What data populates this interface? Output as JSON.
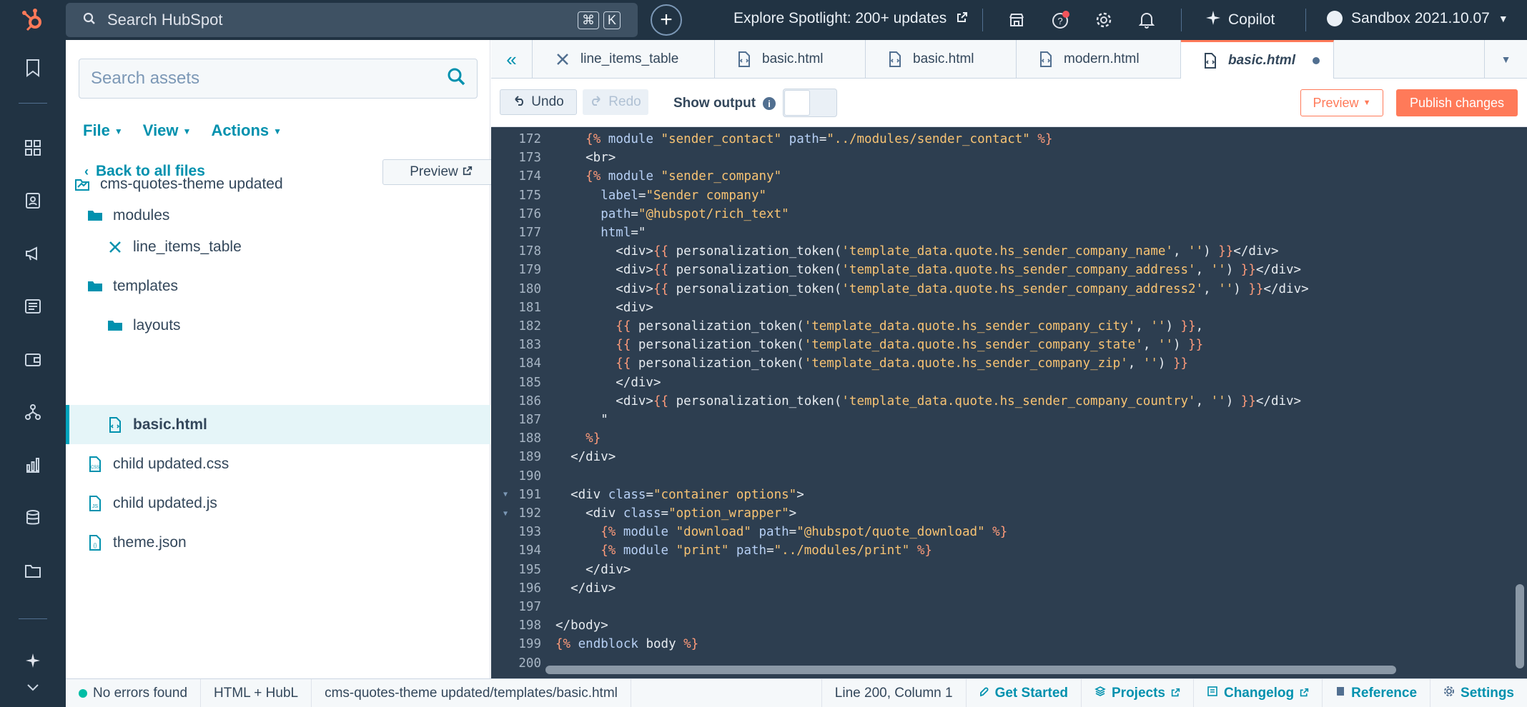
{
  "topbar": {
    "search_placeholder": "Search HubSpot",
    "shortcut_keys": [
      "⌘",
      "K"
    ],
    "spotlight": "Explore Spotlight: 200+ updates",
    "copilot": "Copilot",
    "account": "Sandbox 2021.10.07"
  },
  "sidebar": {
    "search_placeholder": "Search assets",
    "menus": [
      "File",
      "View",
      "Actions"
    ],
    "back_label": "Back to all files",
    "preview_label": "Preview",
    "tree": [
      {
        "label": "cms-quotes-theme updated",
        "icon": "theme-icon"
      },
      {
        "label": "modules",
        "icon": "folder-open-icon"
      },
      {
        "label": "line_items_table",
        "icon": "module-icon"
      },
      {
        "label": "templates",
        "icon": "folder-open-icon"
      },
      {
        "label": "layouts",
        "icon": "folder-icon"
      },
      {
        "label": "basic.html",
        "icon": "html-file-icon",
        "selected": true
      },
      {
        "label": "child updated.css",
        "icon": "css-file-icon"
      },
      {
        "label": "child updated.js",
        "icon": "js-file-icon"
      },
      {
        "label": "theme.json",
        "icon": "json-file-icon"
      }
    ]
  },
  "tabs": [
    {
      "label": "line_items_table",
      "icon": "module-icon"
    },
    {
      "label": "basic.html",
      "icon": "html-file-icon"
    },
    {
      "label": "basic.html",
      "icon": "html-file-icon"
    },
    {
      "label": "modern.html",
      "icon": "html-file-icon"
    },
    {
      "label": "basic.html",
      "icon": "html-file-icon",
      "active": true,
      "unsaved": true
    }
  ],
  "toolbar": {
    "undo": "Undo",
    "redo": "Redo",
    "show_output": "Show output",
    "preview": "Preview",
    "publish": "Publish changes"
  },
  "editor": {
    "lines": [
      {
        "n": "172",
        "code": "    {% module \"sender_contact\" path=\"../modules/sender_contact\" %}"
      },
      {
        "n": "173",
        "code": "    <br>"
      },
      {
        "n": "174",
        "code": "    {% module \"sender_company\""
      },
      {
        "n": "175",
        "code": "      label=\"Sender company\""
      },
      {
        "n": "176",
        "code": "      path=\"@hubspot/rich_text\""
      },
      {
        "n": "177",
        "code": "      html=\""
      },
      {
        "n": "178",
        "code": "        <div>{{ personalization_token('template_data.quote.hs_sender_company_name', '') }}</div>"
      },
      {
        "n": "179",
        "code": "        <div>{{ personalization_token('template_data.quote.hs_sender_company_address', '') }}</div>"
      },
      {
        "n": "180",
        "code": "        <div>{{ personalization_token('template_data.quote.hs_sender_company_address2', '') }}</div>"
      },
      {
        "n": "181",
        "code": "        <div>"
      },
      {
        "n": "182",
        "code": "        {{ personalization_token('template_data.quote.hs_sender_company_city', '') }},"
      },
      {
        "n": "183",
        "code": "        {{ personalization_token('template_data.quote.hs_sender_company_state', '') }}"
      },
      {
        "n": "184",
        "code": "        {{ personalization_token('template_data.quote.hs_sender_company_zip', '') }}"
      },
      {
        "n": "185",
        "code": "        </div>"
      },
      {
        "n": "186",
        "code": "        <div>{{ personalization_token('template_data.quote.hs_sender_company_country', '') }}</div>"
      },
      {
        "n": "187",
        "code": "      \""
      },
      {
        "n": "188",
        "code": "    %}"
      },
      {
        "n": "189",
        "code": "  </div>"
      },
      {
        "n": "190",
        "code": ""
      },
      {
        "n": "191",
        "code": "  <div class=\"container options\">",
        "fold": true
      },
      {
        "n": "192",
        "code": "    <div class=\"option_wrapper\">",
        "fold": true
      },
      {
        "n": "193",
        "code": "      {% module \"download\" path=\"@hubspot/quote_download\" %}"
      },
      {
        "n": "194",
        "code": "      {% module \"print\" path=\"../modules/print\" %}"
      },
      {
        "n": "195",
        "code": "    </div>"
      },
      {
        "n": "196",
        "code": "  </div>"
      },
      {
        "n": "197",
        "code": ""
      },
      {
        "n": "198",
        "code": "</body>"
      },
      {
        "n": "199",
        "code": "{% endblock body %}"
      },
      {
        "n": "200",
        "code": ""
      }
    ]
  },
  "statusbar": {
    "errors": "No errors found",
    "language": "HTML + HubL",
    "path": "cms-quotes-theme updated/templates/basic.html",
    "position": "Line 200, Column 1",
    "get_started": "Get Started",
    "projects": "Projects",
    "changelog": "Changelog",
    "reference": "Reference",
    "settings": "Settings"
  },
  "colors": {
    "nav_bg": "#213343",
    "accent": "#ff7a59",
    "link": "#0091ae",
    "editor_bg": "#2d3e50",
    "selection_bg": "#e5f5f8"
  }
}
